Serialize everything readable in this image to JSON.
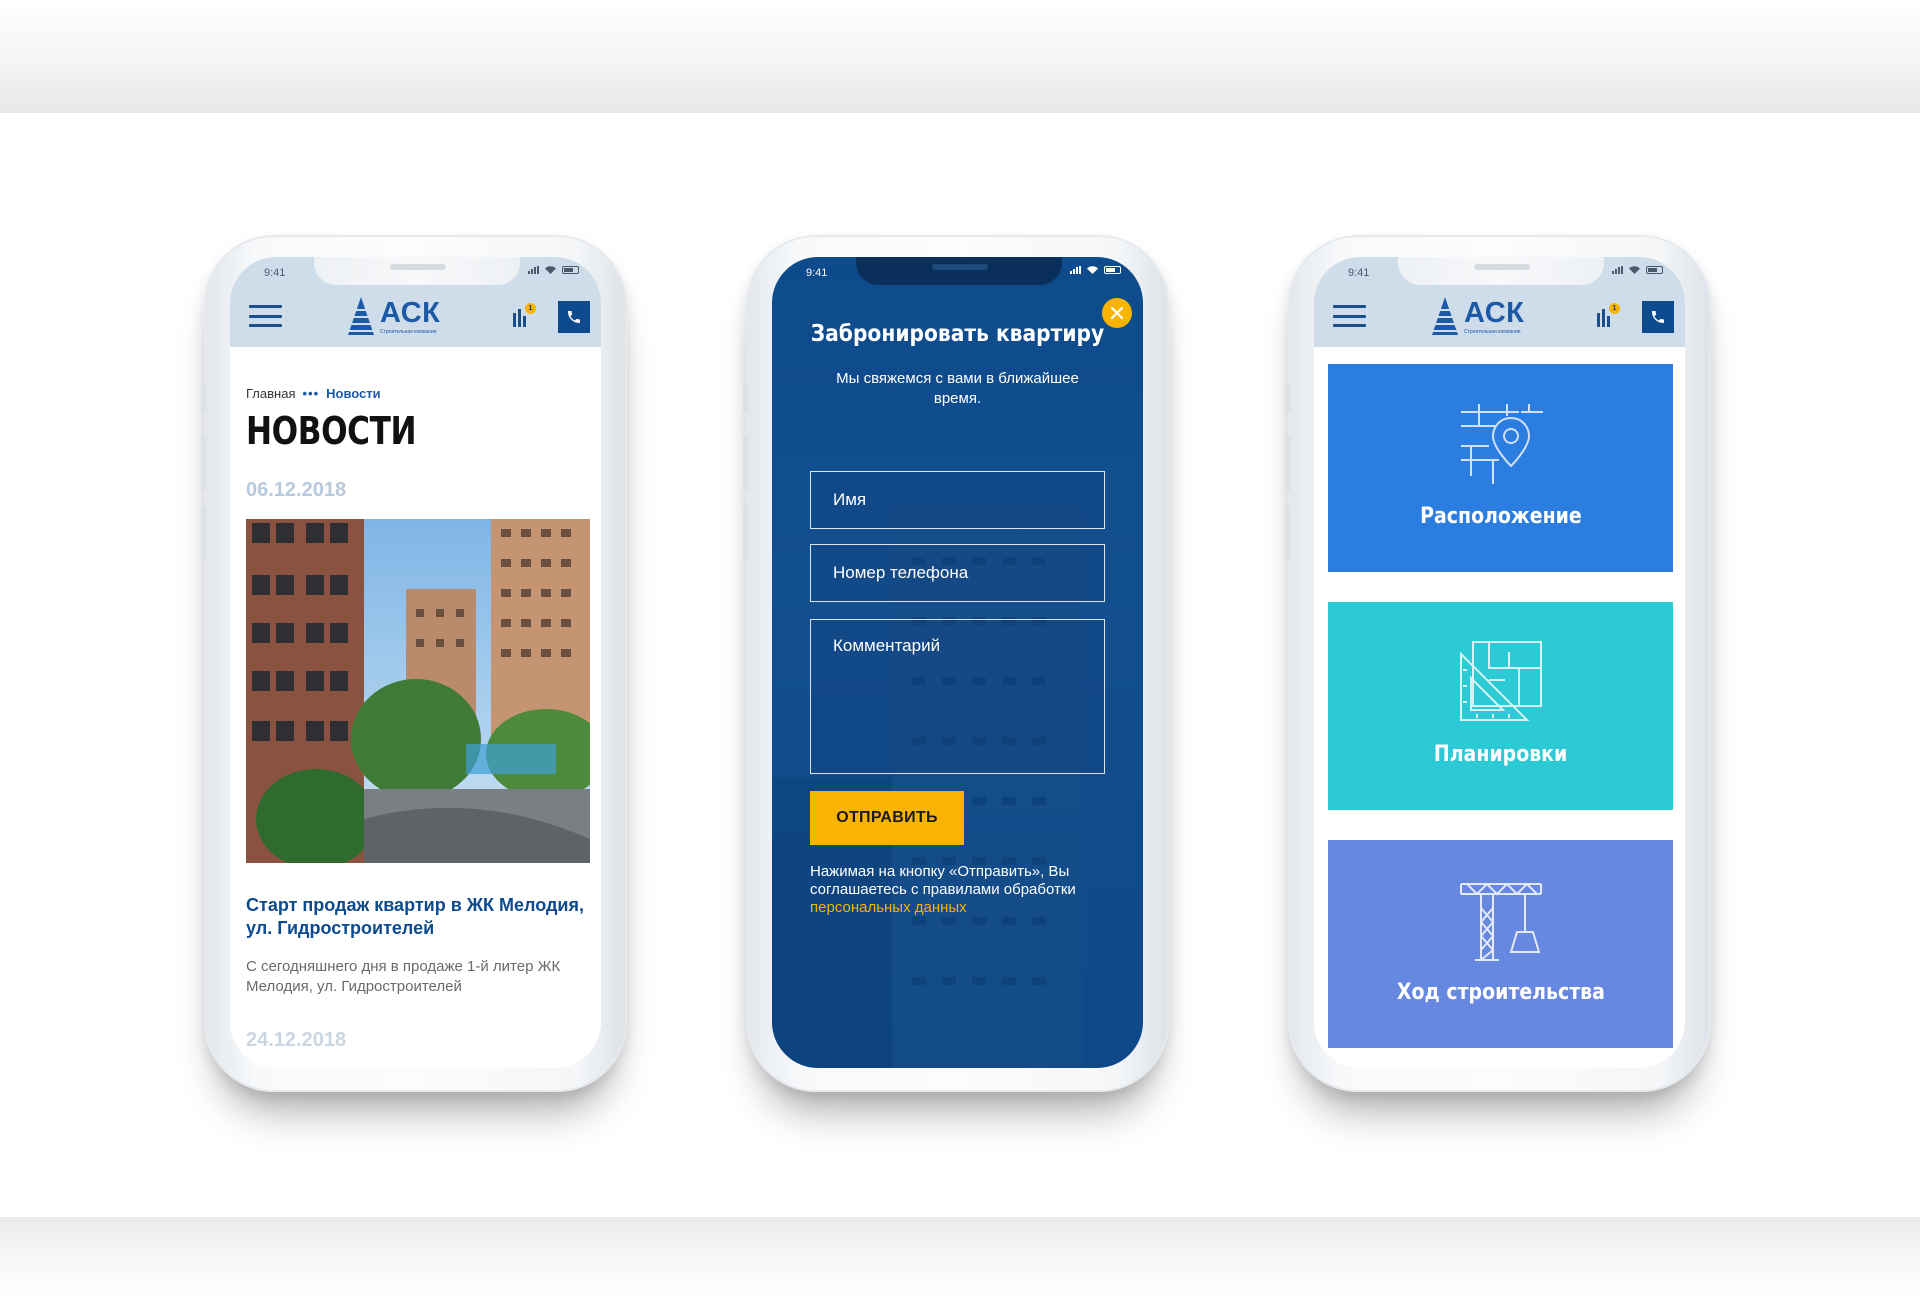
{
  "status": {
    "time": "9:41"
  },
  "brand": {
    "name": "АСК",
    "tagline": "Строительная компания"
  },
  "compare": {
    "count": "1"
  },
  "news_page": {
    "breadcrumb_home": "Главная",
    "breadcrumb_sep": "•••",
    "breadcrumb_current": "Новости",
    "title": "НОВОСТИ",
    "items": [
      {
        "date": "06.12.2018",
        "title": "Старт продаж квартир в ЖК Мелодия, ул. Гидростроителей",
        "text": "С сегодняшнего дня в продаже 1-й литер ЖК Мелодия, ул. Гидростроителей"
      },
      {
        "date": "24.12.2018"
      }
    ]
  },
  "booking_modal": {
    "title": "Забронировать квартиру",
    "subtitle": "Мы свяжемся с вами в ближайшее время.",
    "name_placeholder": "Имя",
    "phone_placeholder": "Номер телефона",
    "comment_placeholder": "Комментарий",
    "submit_label": "ОТПРАВИТЬ",
    "consent_text": "Нажимая на кнопку «Отправить», Вы соглашаетесь с правилами обработки",
    "consent_link": "персональных данных"
  },
  "tiles": [
    {
      "label": "Расположение",
      "icon": "location-map-icon",
      "color": "#2b7de0"
    },
    {
      "label": "Планировки",
      "icon": "floor-plan-icon",
      "color": "#2ccad5"
    },
    {
      "label": "Ход строительства",
      "icon": "crane-icon",
      "color": "#6688e0"
    }
  ],
  "colors": {
    "brand_blue": "#1c59a6",
    "header_bg": "#cfdcea",
    "accent_yellow": "#f8b400",
    "modal_bg": "#0e4b8c"
  }
}
